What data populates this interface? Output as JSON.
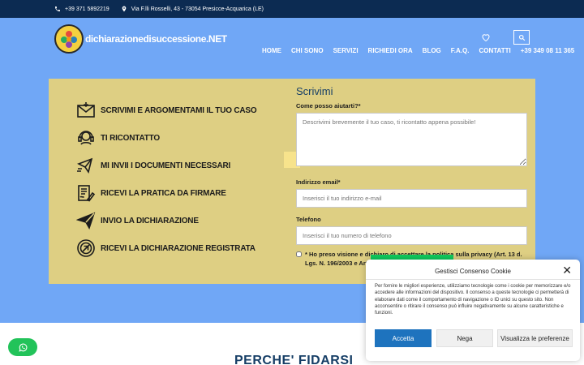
{
  "topbar": {
    "phone": "+39 371 5892219",
    "address": "Via F.lli Rosselli, 43 - 73054 Presicce-Acquarica (LE)"
  },
  "brand": {
    "name": "dichiarazionedisuccessione.NET"
  },
  "nav": {
    "items": [
      "HOME",
      "CHI SONO",
      "SERVIZI",
      "RICHIEDI ORA",
      "BLOG",
      "F.A.Q.",
      "CONTATTI",
      "+39 349 08 11 365"
    ]
  },
  "steps": [
    {
      "icon": "envelope-icon",
      "label": "SCRIVIMI E ARGOMENTAMI IL TUO CASO"
    },
    {
      "icon": "headset-icon",
      "label": "TI RICONTATTO"
    },
    {
      "icon": "send-docs-icon",
      "label": "MI INVII I DOCUMENTI NECESSARI"
    },
    {
      "icon": "document-sign-icon",
      "label": "RICEVI LA PRATICA DA FIRMARE"
    },
    {
      "icon": "paper-plane-icon",
      "label": "INVIO LA DICHIARAZIONE"
    },
    {
      "icon": "stamp-icon",
      "label": "RICEVI LA DICHIARAZIONE REGISTRATA"
    }
  ],
  "form": {
    "title": "Scrivimi",
    "help_label": "Come posso aiutarti?*",
    "help_placeholder": "Descrivimi brevemente il tuo caso, ti ricontatto appena possibile!",
    "email_label": "Indirizzo email*",
    "email_placeholder": "Inserisci il tuo indirizzo e-mail",
    "phone_label": "Telefono",
    "phone_placeholder": "Inserisci il tuo numero di telefono",
    "privacy_text": "* Ho preso visione e dichiaro di accettare la politica sulla privacy (Art. 13 d. Lgs. N. 196/2003 e Artt 13-14 Reg. UE 2016/679)"
  },
  "section_heading": "PERCHE' FIDARSI",
  "cookie": {
    "title": "Gestisci Consenso Cookie",
    "body": "Per fornire le migliori esperienze, utilizziamo tecnologie come i cookie per memorizzare e/o accedere alle informazioni del dispositivo. Il consenso a queste tecnologie ci permetterà di elaborare dati come il comportamento di navigazione o ID unici su questo sito. Non acconsentire o ritirare il consenso può influire negativamente su alcune caratteristiche e funzioni.",
    "accept": "Accetta",
    "deny": "Nega",
    "preferences": "Visualizza le preferenze"
  },
  "colors": {
    "topbar": "#0c2b52",
    "hero": "#70a7f6",
    "card": "#decf83",
    "accent_green": "#10c95c",
    "accept_button": "#1e73be",
    "whatsapp": "#22c35a"
  }
}
